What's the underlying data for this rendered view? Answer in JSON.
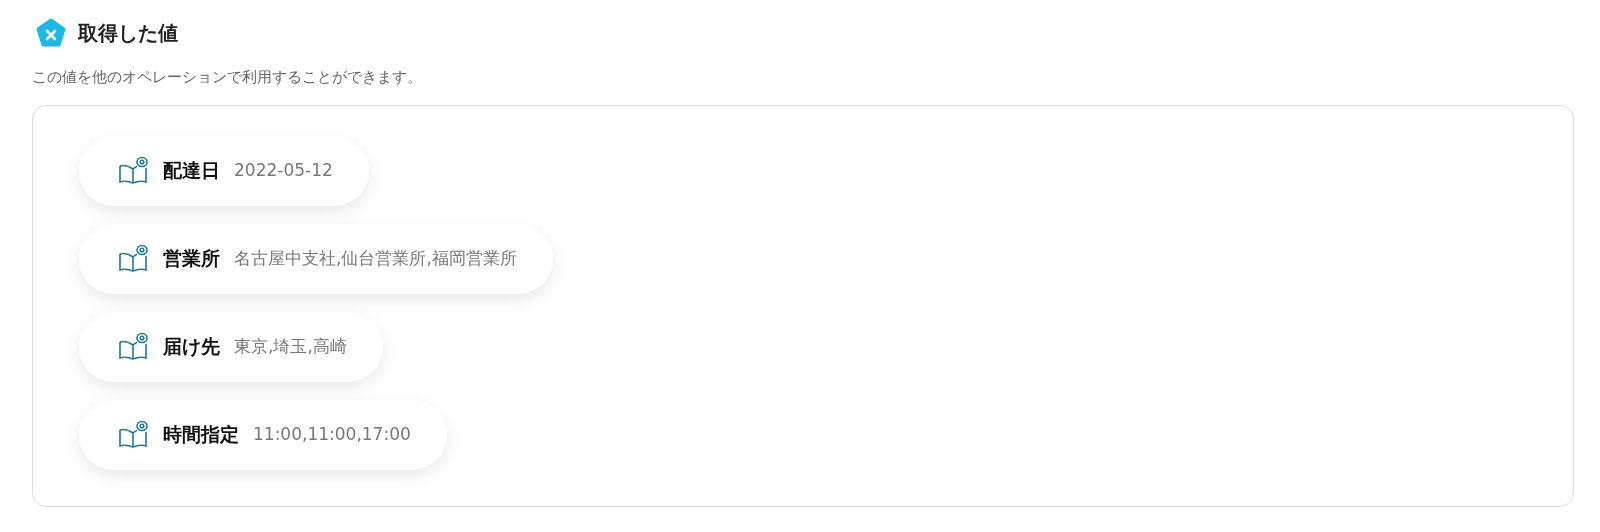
{
  "header": {
    "title": "取得した値",
    "description": "この値を他のオペレーションで利用することができます。"
  },
  "values": [
    {
      "label": "配達日",
      "value": "2022-05-12"
    },
    {
      "label": "営業所",
      "value": "名古屋中支社,仙台営業所,福岡営業所"
    },
    {
      "label": "届け先",
      "value": "東京,埼玉,高崎"
    },
    {
      "label": "時間指定",
      "value": "11:00,11:00,17:00"
    }
  ]
}
